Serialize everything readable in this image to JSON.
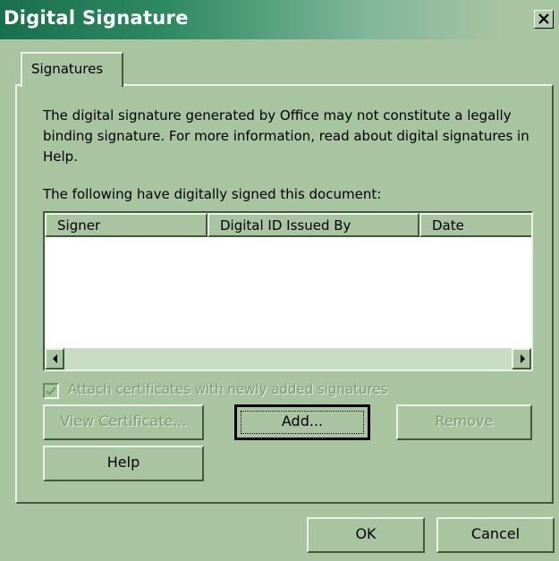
{
  "window": {
    "title": "Digital Signature"
  },
  "tabs": [
    {
      "label": "Signatures"
    }
  ],
  "description": "The digital signature generated by Office may not constitute a legally binding signature. For more information, read about digital signatures in Help.",
  "list": {
    "caption": "The following have digitally signed this document:",
    "columns": [
      "Signer",
      "Digital ID Issued By",
      "Date"
    ],
    "rows": []
  },
  "checkbox": {
    "label": "Attach certificates with newly added signatures",
    "checked": true,
    "enabled": false
  },
  "buttons": {
    "view_certificate": "View Certificate...",
    "add": "Add...",
    "remove": "Remove",
    "help": "Help",
    "ok": "OK",
    "cancel": "Cancel"
  },
  "icons": {
    "close": "close-icon",
    "scroll_left": "scroll-left-arrow-icon",
    "scroll_right": "scroll-right-arrow-icon",
    "check": "checkmark-icon"
  },
  "colors": {
    "dialog_bg": "#a9c4a1",
    "titlebar_start": "#18704e",
    "disabled_text": "#7f9a79"
  }
}
